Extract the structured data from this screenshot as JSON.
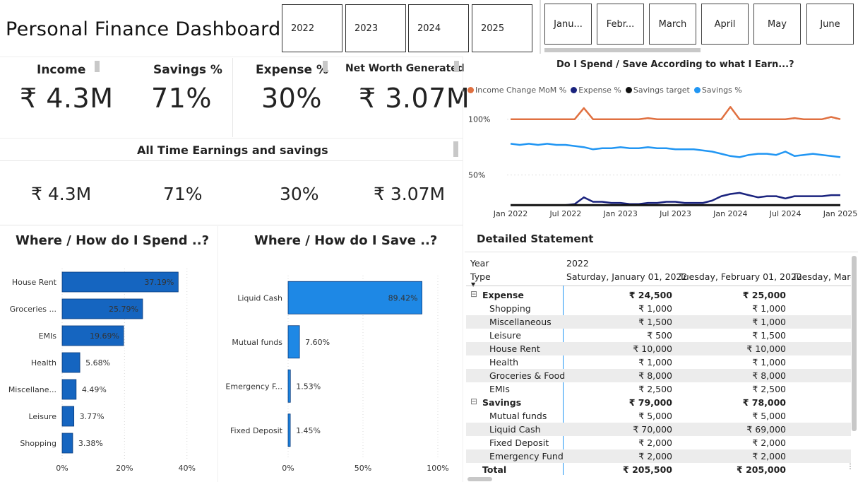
{
  "title": "Personal Finance Dashboard",
  "years": [
    "2022",
    "2023",
    "2024",
    "2025"
  ],
  "months": [
    "Janu...",
    "Febr...",
    "March",
    "April",
    "May",
    "June"
  ],
  "kpis": [
    {
      "label": "Income",
      "value": "₹ 4.3M",
      "value2": "₹ 4.3M"
    },
    {
      "label": "Savings %",
      "value": "71%",
      "value2": "71%"
    },
    {
      "label": "Expense %",
      "value": "30%",
      "value2": "30%"
    },
    {
      "label": "Net Worth Generated",
      "value": "₹ 3.07M",
      "value2": "₹ 3.07M"
    }
  ],
  "all_time_title": "All Time Earnings  and savings",
  "spend_title": "Where / How do I Spend ..?",
  "save_title": "Where / How do I Save ..?",
  "line_title": "Do I Spend / Save According to what I Earn...?",
  "table_title": "Detailed Statement",
  "chart_data": [
    {
      "type": "bar",
      "title": "Where / How do I Spend ..?",
      "categories": [
        "House Rent",
        "Groceries ...",
        "EMIs",
        "Health",
        "Miscellane...",
        "Leisure",
        "Shopping"
      ],
      "values": [
        37.19,
        25.79,
        19.69,
        5.68,
        4.49,
        3.77,
        3.38
      ],
      "labels": [
        "37.19%",
        "25.79%",
        "19.69%",
        "5.68%",
        "4.49%",
        "3.77%",
        "3.38%"
      ],
      "xticks": [
        "0%",
        "20%",
        "40%"
      ],
      "xlim": [
        0,
        43
      ],
      "color": "#1565c0"
    },
    {
      "type": "bar",
      "title": "Where / How do I Save ..?",
      "categories": [
        "Liquid Cash",
        "Mutual funds",
        "Emergency F...",
        "Fixed Deposit"
      ],
      "values": [
        89.42,
        7.6,
        1.53,
        1.45
      ],
      "labels": [
        "89.42%",
        "7.60%",
        "1.53%",
        "1.45%"
      ],
      "xticks": [
        "0%",
        "50%",
        "100%"
      ],
      "xlim": [
        0,
        100
      ],
      "color": "#1e88e5"
    },
    {
      "type": "line",
      "title": "Do I Spend / Save According to what I Earn...?",
      "x": [
        "2022-01",
        "2022-02",
        "2022-03",
        "2022-04",
        "2022-05",
        "2022-06",
        "2022-07",
        "2022-08",
        "2022-09",
        "2022-10",
        "2022-11",
        "2022-12",
        "2023-01",
        "2023-02",
        "2023-03",
        "2023-04",
        "2023-05",
        "2023-06",
        "2023-07",
        "2023-08",
        "2023-09",
        "2023-10",
        "2023-11",
        "2023-12",
        "2024-01",
        "2024-02",
        "2024-03",
        "2024-04",
        "2024-05",
        "2024-06",
        "2024-07",
        "2024-08",
        "2024-09",
        "2024-10",
        "2024-11",
        "2024-12",
        "2025-01"
      ],
      "xticks": [
        "Jan 2022",
        "Jul 2022",
        "Jan 2023",
        "Jul 2023",
        "Jan 2024",
        "Jul 2024",
        "Jan 2025"
      ],
      "yticks": [
        "100%",
        "50%"
      ],
      "ylim": [
        20,
        115
      ],
      "series": [
        {
          "name": "Income Change MoM %",
          "color": "#e07040",
          "values": [
            100,
            100,
            100,
            100,
            100,
            100,
            100,
            100,
            110,
            100,
            100,
            100,
            100,
            100,
            100,
            101,
            100,
            100,
            100,
            100,
            100,
            100,
            100,
            100,
            111,
            100,
            100,
            100,
            100,
            100,
            100,
            101,
            100,
            100,
            100,
            102,
            100
          ]
        },
        {
          "name": "Expense %",
          "color": "#1a237e",
          "values": [
            23,
            23,
            23,
            23,
            23,
            23,
            23,
            24,
            30,
            26,
            26,
            25,
            25,
            24,
            24,
            25,
            25,
            26,
            26,
            25,
            25,
            25,
            27,
            31,
            33,
            34,
            32,
            30,
            31,
            31,
            29,
            31,
            31,
            31,
            31,
            32,
            32
          ]
        },
        {
          "name": "Savings target",
          "color": "#111111",
          "values": [
            23,
            23,
            23,
            23,
            23,
            23,
            23,
            23,
            23,
            23,
            23,
            23,
            23,
            23,
            23,
            23,
            23,
            23,
            23,
            23,
            23,
            23,
            23,
            23,
            23,
            23,
            23,
            23,
            23,
            23,
            23,
            23,
            23,
            23,
            23,
            23,
            23
          ]
        },
        {
          "name": "Savings %",
          "color": "#2196f3",
          "values": [
            78,
            77,
            78,
            77,
            78,
            77,
            77,
            76,
            75,
            73,
            74,
            74,
            75,
            74,
            74,
            75,
            74,
            74,
            73,
            73,
            73,
            72,
            71,
            69,
            67,
            66,
            68,
            69,
            69,
            68,
            71,
            67,
            68,
            69,
            68,
            67,
            66
          ]
        }
      ]
    }
  ],
  "statement": {
    "year_label": "Year",
    "year_value": "2022",
    "type_label": "Type",
    "columns": [
      "Saturday, January 01, 2022",
      "Tuesday, February 01, 2022",
      "Tuesday, March"
    ],
    "rows": [
      {
        "label": "Expense",
        "c1": "₹ 24,500",
        "c2": "₹ 25,000",
        "bold": true,
        "expander": "⊟"
      },
      {
        "label": "Shopping",
        "c1": "₹ 1,000",
        "c2": "₹ 1,000"
      },
      {
        "label": "Miscellaneous",
        "c1": "₹ 1,500",
        "c2": "₹ 1,000"
      },
      {
        "label": "Leisure",
        "c1": "₹ 500",
        "c2": "₹ 1,500"
      },
      {
        "label": "House Rent",
        "c1": "₹ 10,000",
        "c2": "₹ 10,000"
      },
      {
        "label": "Health",
        "c1": "₹ 1,000",
        "c2": "₹ 1,000"
      },
      {
        "label": "Groceries & Food",
        "c1": "₹ 8,000",
        "c2": "₹ 8,000"
      },
      {
        "label": "EMIs",
        "c1": "₹ 2,500",
        "c2": "₹ 2,500"
      },
      {
        "label": "Savings",
        "c1": "₹ 79,000",
        "c2": "₹ 78,000",
        "bold": true,
        "expander": "⊟"
      },
      {
        "label": "Mutual funds",
        "c1": "₹ 5,000",
        "c2": "₹ 5,000"
      },
      {
        "label": "Liquid Cash",
        "c1": "₹ 70,000",
        "c2": "₹ 69,000"
      },
      {
        "label": "Fixed Deposit",
        "c1": "₹ 2,000",
        "c2": "₹ 2,000"
      },
      {
        "label": "Emergency Fund",
        "c1": "₹ 2,000",
        "c2": "₹ 2,000"
      },
      {
        "label": "Total",
        "c1": "₹ 205,500",
        "c2": "₹ 205,000",
        "bold": true
      }
    ]
  }
}
